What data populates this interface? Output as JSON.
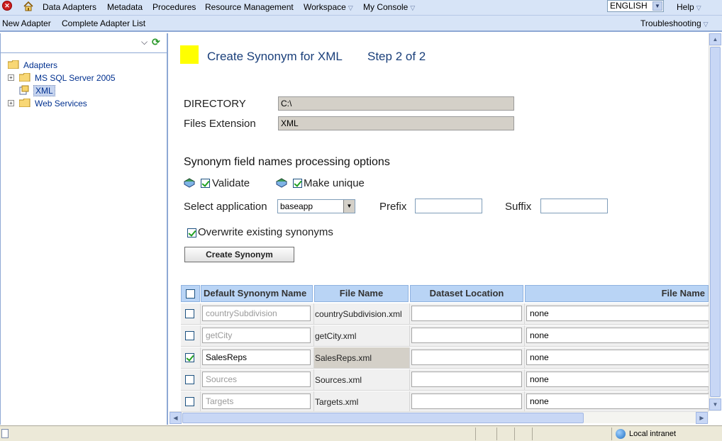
{
  "menubar": {
    "items": [
      {
        "label": "Data Adapters",
        "chevron": false
      },
      {
        "label": "Metadata",
        "chevron": false
      },
      {
        "label": "Procedures",
        "chevron": false
      },
      {
        "label": "Resource Management",
        "chevron": false
      },
      {
        "label": "Workspace",
        "chevron": true
      },
      {
        "label": "My Console",
        "chevron": true
      }
    ],
    "language": "ENGLISH",
    "help": "Help"
  },
  "toolbar": {
    "new_adapter": "New Adapter",
    "complete_list": "Complete Adapter List",
    "troubleshooting": "Troubleshooting"
  },
  "tree": {
    "root": "Adapters",
    "items": [
      {
        "label": "MS SQL Server 2005",
        "icon": "folder-icon",
        "expandable": true
      },
      {
        "label": "XML",
        "icon": "adapter-icon",
        "expandable": false,
        "selected": true
      },
      {
        "label": "Web Services",
        "icon": "folder-icon",
        "expandable": true
      }
    ]
  },
  "main": {
    "title": "Create Synonym for XML",
    "step": "Step 2 of 2",
    "directory_label": "DIRECTORY",
    "directory_value": "C:\\",
    "extension_label": "Files Extension",
    "extension_value": "XML",
    "section_title": "Synonym field names processing options",
    "validate_label": "Validate",
    "validate_checked": true,
    "make_unique_label": "Make unique",
    "make_unique_checked": true,
    "select_app_label": "Select application",
    "select_app_value": "baseapp",
    "prefix_label": "Prefix",
    "prefix_value": "",
    "suffix_label": "Suffix",
    "suffix_value": "",
    "overwrite_label": "Overwrite existing synonyms",
    "overwrite_checked": true,
    "create_button": "Create Synonym"
  },
  "grid": {
    "headers": [
      "Default Synonym Name",
      "File Name",
      "Dataset Location",
      "File Name"
    ],
    "rows": [
      {
        "checked": false,
        "synonym": "countrySubdivision",
        "file": "countrySubdivision.xml",
        "location": "",
        "file2": "none"
      },
      {
        "checked": false,
        "synonym": "getCity",
        "file": "getCity.xml",
        "location": "",
        "file2": "none"
      },
      {
        "checked": true,
        "synonym": "SalesReps",
        "file": "SalesReps.xml",
        "location": "",
        "file2": "none"
      },
      {
        "checked": false,
        "synonym": "Sources",
        "file": "Sources.xml",
        "location": "",
        "file2": "none"
      },
      {
        "checked": false,
        "synonym": "Targets",
        "file": "Targets.xml",
        "location": "",
        "file2": "none"
      }
    ]
  },
  "statusbar": {
    "zone": "Local intranet"
  },
  "colors": {
    "accent_yellow": "#ffff00",
    "title_blue": "#1a3f7a",
    "header_blue": "#b9d4f5"
  }
}
